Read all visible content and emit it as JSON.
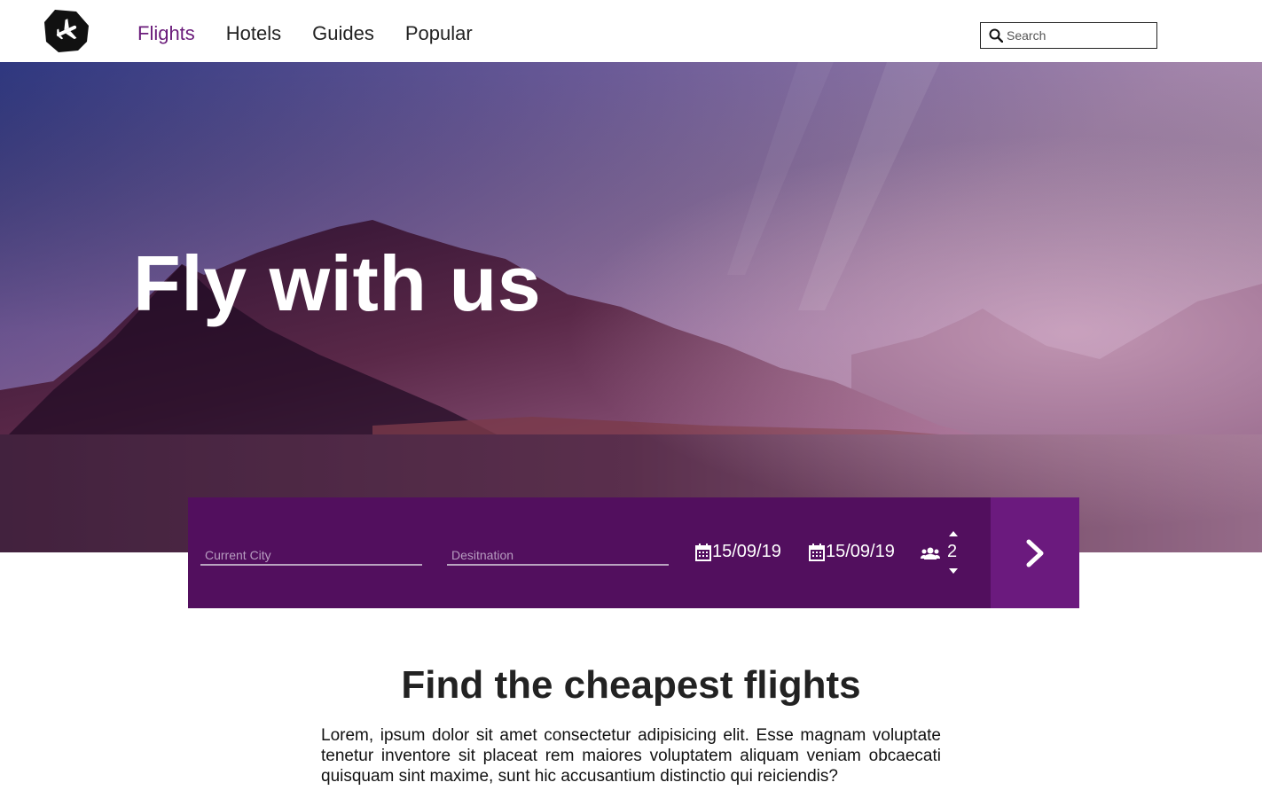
{
  "header": {
    "logo_icon": "airplane-logo-icon",
    "nav": [
      {
        "label": "Flights",
        "active": true
      },
      {
        "label": "Hotels",
        "active": false
      },
      {
        "label": "Guides",
        "active": false
      },
      {
        "label": "Popular",
        "active": false
      }
    ],
    "search": {
      "placeholder": "Search",
      "icon": "search-icon"
    }
  },
  "hero": {
    "title": "Fly with us"
  },
  "booking": {
    "current_city_placeholder": "Current City",
    "destination_placeholder": "Desitnation",
    "departure_date": "15/09/19",
    "return_date": "15/09/19",
    "passengers": "2",
    "calendar_icon": "calendar-icon",
    "passengers_icon": "users-icon",
    "go_icon": "chevron-right-icon"
  },
  "content": {
    "title": "Find the cheapest flights",
    "text": "Lorem, ipsum dolor sit amet consectetur adipisicing elit. Esse magnam voluptate tenetur inventore sit placeat rem maiores voluptatem aliquam veniam obcaecati quisquam sint maxime, sunt hic accusantium distinctio qui reiciendis?"
  },
  "colors": {
    "accent": "#6a1b7a",
    "booking_bar": "#520f5e",
    "go_button": "#6b1a7e"
  }
}
